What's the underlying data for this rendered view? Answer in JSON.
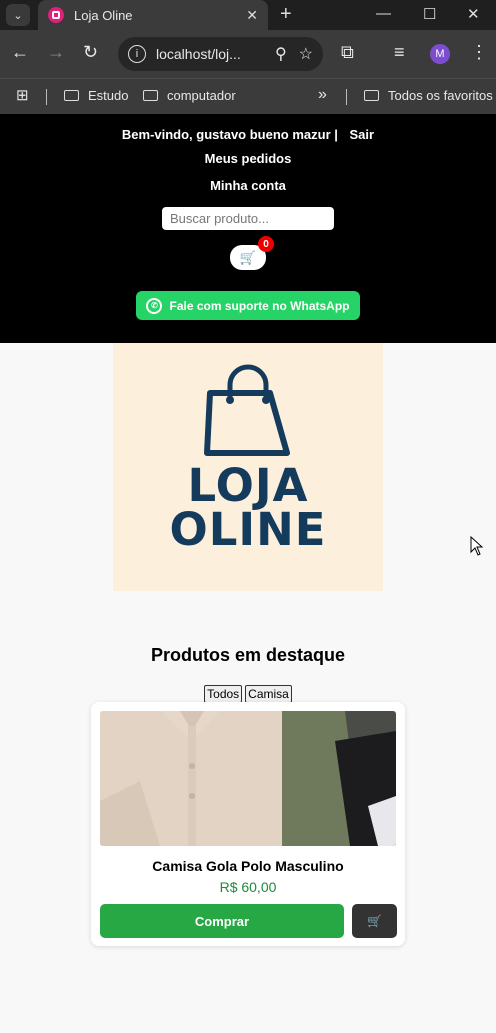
{
  "browser": {
    "tab_title": "Loja Oline",
    "url": "localhost/loj...",
    "profile_initial": "M",
    "bookmarks": [
      "Estudo",
      "computador",
      "Todos os favoritos"
    ],
    "overflow": "»"
  },
  "header": {
    "welcome": "Bem-vindo, gustavo bueno mazur |",
    "logout": "Sair",
    "orders": "Meus pedidos",
    "account": "Minha conta",
    "search_placeholder": "Buscar produto...",
    "cart_icon": "🛒",
    "cart_count": "0",
    "whatsapp": "Fale com suporte no WhatsApp"
  },
  "logo": {
    "line1": "LOJA",
    "line2": "OLINE"
  },
  "products": {
    "title": "Produtos em destaque",
    "filters": [
      "Todos",
      "Camisa"
    ],
    "items": [
      {
        "name": "Camisa Gola Polo Masculino",
        "price": "R$ 60,00",
        "buy_label": "Comprar",
        "cart_icon": "🛒"
      }
    ]
  },
  "colors": {
    "header_bg": "#000000",
    "whatsapp": "#25d366",
    "buy": "#28a745",
    "price": "#1e8a3a",
    "logo_bg": "#fcf0dd",
    "logo_fg": "#143b5c"
  }
}
